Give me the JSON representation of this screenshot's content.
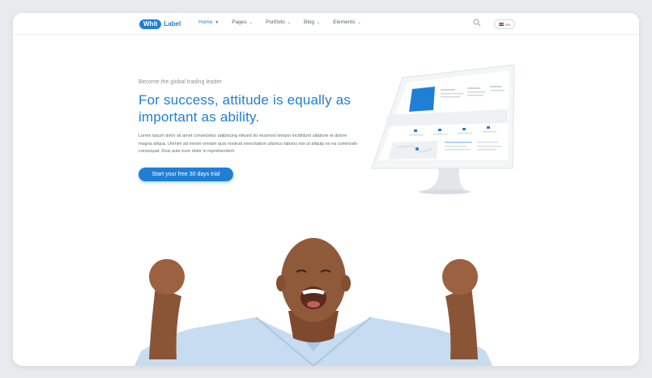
{
  "logo": {
    "part1": "Whit",
    "part2": "Label"
  },
  "nav": {
    "items": [
      {
        "label": "Home",
        "active": true
      },
      {
        "label": "Pages",
        "active": false
      },
      {
        "label": "Portfolio",
        "active": false
      },
      {
        "label": "Blog",
        "active": false
      },
      {
        "label": "Elements",
        "active": false
      }
    ],
    "chevron": "⌄"
  },
  "lang": {
    "code": "EN",
    "icon": "us-flag-icon"
  },
  "icons": {
    "search": "search-icon"
  },
  "hero": {
    "eyebrow": "Become the global trading leader",
    "title": "For success, attitude is equally as important as ability.",
    "body": "Lorem ipsum dolor sit amet consectetur adipiscing elitsed do eiusmod tempor incididunt utlabore et dolore magna aliqua. Utenim ad minim veniam quis nostrud exercitation ullamco labons nisi ut aliquip ex ea commodo consequat. Duis aute irure dolor in reprehenderit.",
    "cta_label": "Start your free 30 days trial"
  },
  "colors": {
    "accent": "#1f7fd6",
    "text_muted": "#8d939c",
    "bg": "#e9eaed"
  }
}
